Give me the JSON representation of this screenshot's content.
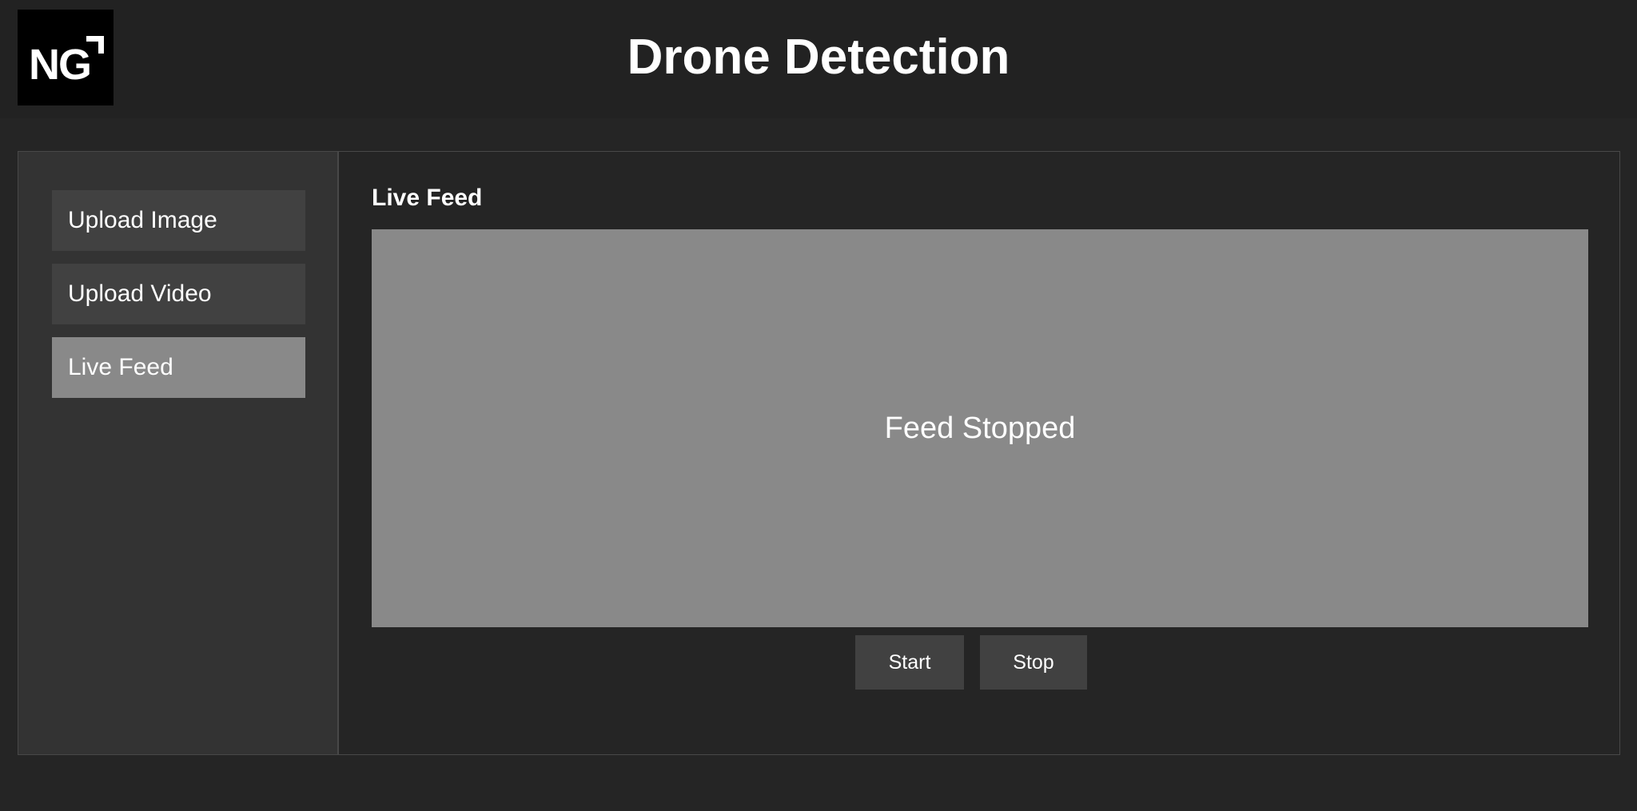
{
  "header": {
    "logo_text": "NG",
    "title": "Drone Detection"
  },
  "sidebar": {
    "items": [
      {
        "label": "Upload Image",
        "active": false
      },
      {
        "label": "Upload Video",
        "active": false
      },
      {
        "label": "Live Feed",
        "active": true
      }
    ]
  },
  "main": {
    "section_title": "Live Feed",
    "feed_status": "Feed Stopped",
    "start_label": "Start",
    "stop_label": "Stop"
  },
  "colors": {
    "background": "#252525",
    "header": "#222222",
    "sidebar": "#333333",
    "nav_item": "#414141",
    "nav_item_active": "#898989",
    "feed_panel": "#898989",
    "text": "#ffffff"
  }
}
